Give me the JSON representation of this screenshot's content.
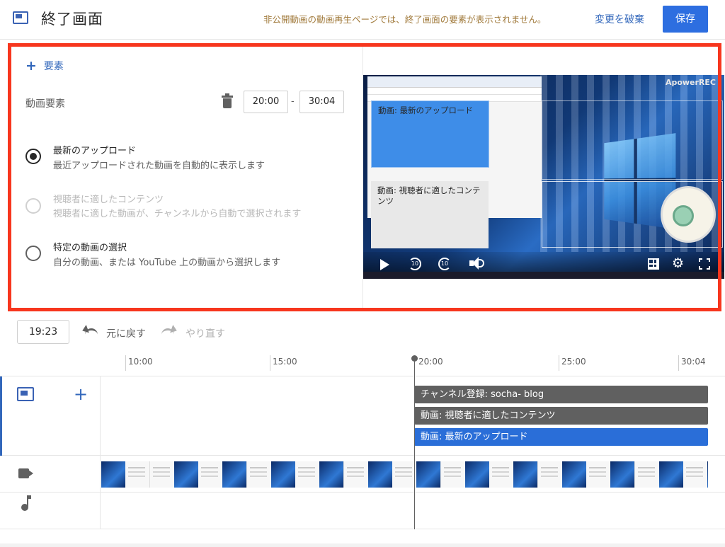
{
  "header": {
    "title": "終了画面",
    "notice": "非公開動画の動画再生ページでは、終了画面の要素が表示されません。",
    "discard_label": "変更を破棄",
    "save_label": "保存",
    "icon": "end-screen-icon"
  },
  "panel": {
    "add_element_label": "要素",
    "element_label": "動画要素",
    "start_time": "20:00",
    "end_time": "30:04",
    "separator": "-",
    "options": [
      {
        "title": "最新のアップロード",
        "description": "最近アップロードされた動画を自動的に表示します",
        "selected": true,
        "disabled": false
      },
      {
        "title": "視聴者に適したコンテンツ",
        "description": "視聴者に適した動画が、チャンネルから自動で選択されます",
        "selected": false,
        "disabled": true
      },
      {
        "title": "特定の動画の選択",
        "description": "自分の動画、または YouTube 上の動画から選択します",
        "selected": false,
        "disabled": false
      }
    ]
  },
  "preview": {
    "watermark": "ApowerREC",
    "card_blue": "動画: 最新のアップロード",
    "card_grey": "動画: 視聴者に適したコンテンツ",
    "controls": [
      "play-icon",
      "rewind-10-icon",
      "forward-10-icon",
      "volume-icon",
      "grid-icon",
      "gear-icon",
      "fullscreen-icon"
    ]
  },
  "timeline": {
    "current_time": "19:23",
    "undo_label": "元に戻す",
    "redo_label": "やり直す",
    "ticks": [
      "10:00",
      "15:00",
      "20:00",
      "25:00",
      "30:04"
    ],
    "elements": [
      {
        "label": "チャンネル登録: socha- blog",
        "color": "#606060"
      },
      {
        "label": "動画: 視聴者に適したコンテンツ",
        "color": "#606060"
      },
      {
        "label": "動画: 最新のアップロード",
        "color": "#2a6ed8"
      }
    ]
  },
  "colors": {
    "accent": "#3267bb",
    "save_button": "#2d6ee0",
    "highlight_frame": "#f7361e",
    "notice_text": "#a0793a"
  }
}
